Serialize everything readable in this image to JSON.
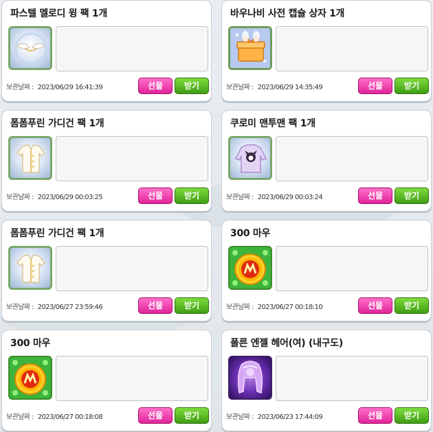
{
  "colors": {
    "gift_button": "#e0249a",
    "receive_button": "#3f9d14",
    "thumb_green": "#3db33c",
    "thumb_purple": "#6a2fb0"
  },
  "date_label": "보관날짜 :",
  "gift_label": "선물",
  "receive_label": "받기",
  "items": [
    {
      "title": "파스텔 멜로디 윙 팩 1개",
      "date": "2023/06/29 16:41:39",
      "icon": "pastel-wing-icon"
    },
    {
      "title": "바우나비 사전 캡슐 상자 1개",
      "date": "2023/06/29 14:35:49",
      "icon": "capsule-box-icon"
    },
    {
      "title": "폼폼푸린 가디건 팩 1개",
      "date": "2023/06/29 00:03:25",
      "icon": "cardigan-icon"
    },
    {
      "title": "쿠로미 맨투맨 팩 1개",
      "date": "2023/06/29 00:03:24",
      "icon": "kuromi-sweatshirt-icon"
    },
    {
      "title": "폼폼푸린 가디건 팩 1개",
      "date": "2023/06/27 23:59:46",
      "icon": "cardigan-icon"
    },
    {
      "title": "300 마우",
      "date": "2023/06/27 00:18:10",
      "icon": "maple-point-icon"
    },
    {
      "title": "300 마우",
      "date": "2023/06/27 00:18:08",
      "icon": "maple-point-icon"
    },
    {
      "title": "폴른 엔젤 헤어(여) (내구도)",
      "date": "2023/06/23 17:44:09",
      "icon": "fallen-angel-hair-icon"
    }
  ]
}
